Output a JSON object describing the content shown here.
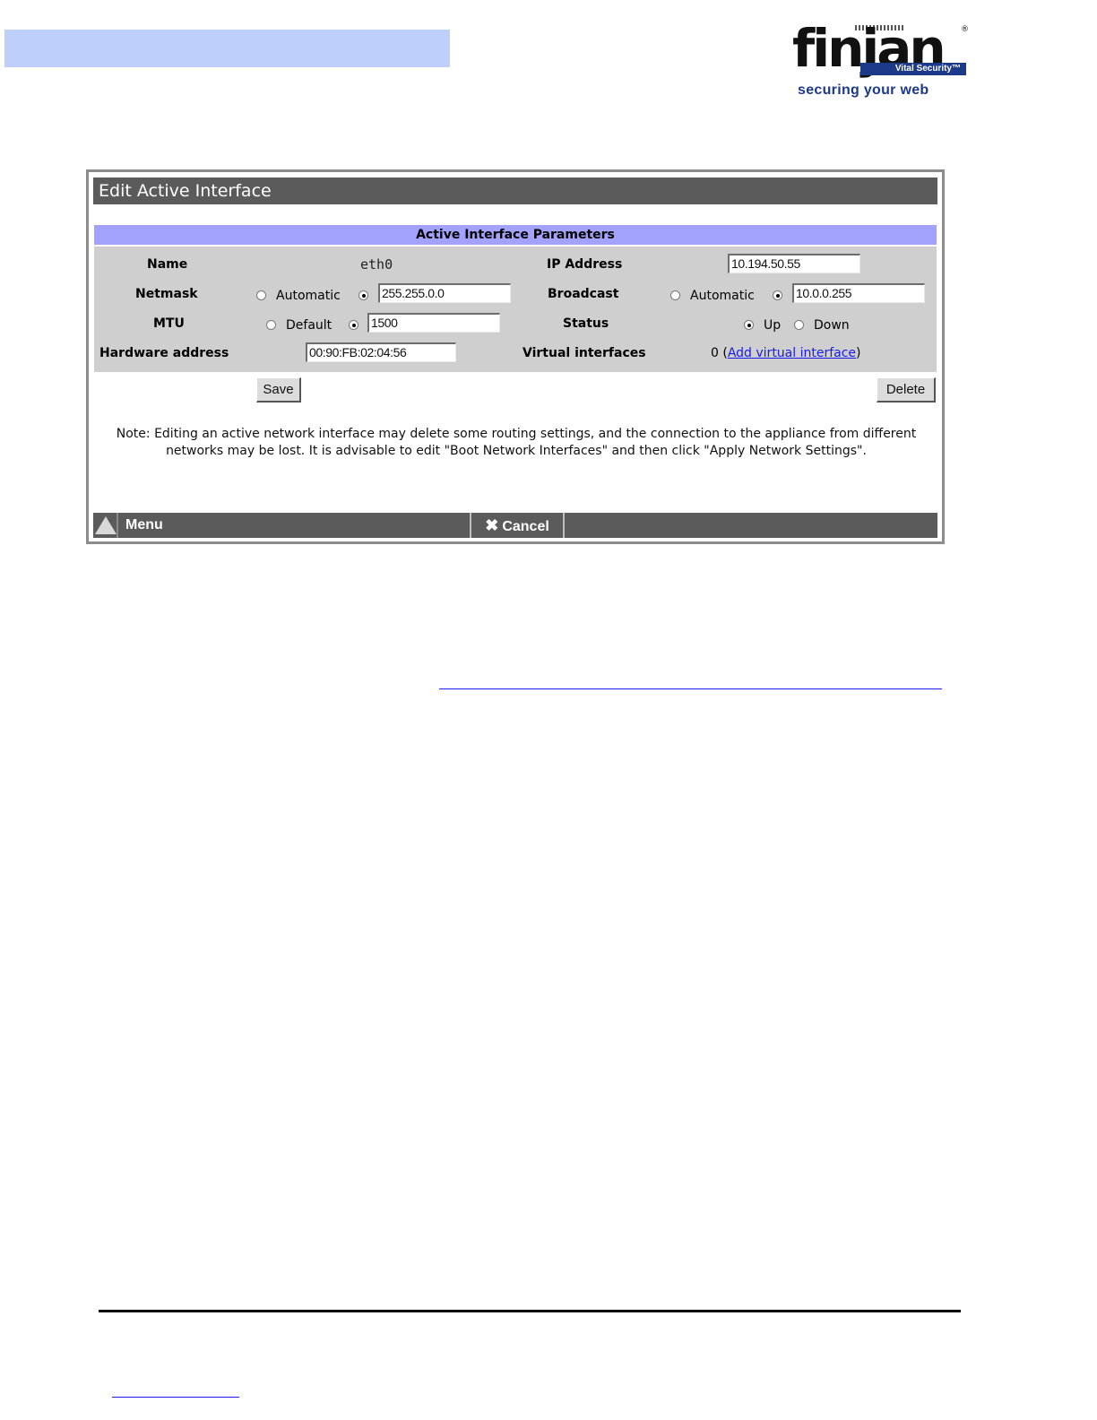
{
  "brand": {
    "name": "finjan",
    "registered_mark": "®",
    "product_badge": "Vital Security™",
    "tagline": "securing your web"
  },
  "window": {
    "title": "Edit Active Interface",
    "section_header": "Active Interface Parameters",
    "fields": {
      "name_label": "Name",
      "name_value": "eth0",
      "ip_label": "IP Address",
      "ip_value": "10.194.50.55",
      "netmask_label": "Netmask",
      "netmask_auto": "Automatic",
      "netmask_value": "255.255.0.0",
      "broadcast_label": "Broadcast",
      "broadcast_auto": "Automatic",
      "broadcast_value": "10.0.0.255",
      "mtu_label": "MTU",
      "mtu_default": "Default",
      "mtu_value": "1500",
      "status_label": "Status",
      "status_up": "Up",
      "status_down": "Down",
      "hw_label": "Hardware address",
      "hw_value": "00:90:FB:02:04:56",
      "virtual_label": "Virtual interfaces",
      "virtual_count": "0 (",
      "virtual_link": "Add virtual interface",
      "virtual_close": ")"
    },
    "buttons": {
      "save": "Save",
      "delete": "Delete"
    },
    "note": "Note: Editing an active network interface may delete some routing settings, and the connection to the appliance from different networks may be lost. It is advisable to edit \"Boot Network Interfaces\" and then click \"Apply Network Settings\".",
    "bottom_bar": {
      "menu": "Menu",
      "cancel": "Cancel"
    }
  },
  "colors": {
    "top_bar": "#bfcffb",
    "title_bar": "#5b5b5b",
    "section_header": "#a3a3ff",
    "panel": "#cfcfcf",
    "link": "#1a1aee",
    "brand_blue": "#1d3a8a"
  }
}
